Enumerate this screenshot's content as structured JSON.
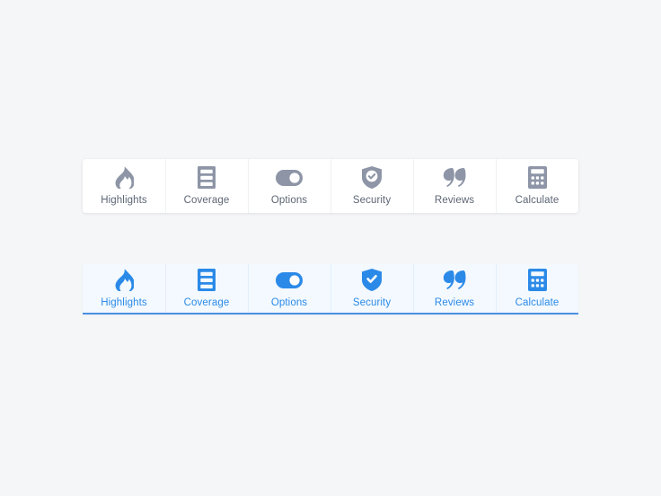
{
  "page": {
    "background_color": "#f5f6f7"
  },
  "colors": {
    "inactive_icon": "#8d95a6",
    "inactive_label": "#5d6675",
    "inactive_background": "#ffffff",
    "inactive_divider": "#f0f1f3",
    "active_icon": "#2b8ae8",
    "active_label": "#2b8ae8",
    "active_background": "#f3f9fe",
    "active_divider": "#e2eefb",
    "active_underline": "#4a90e2"
  },
  "tabbars": [
    {
      "name": "inactive-tabbar",
      "state": "default",
      "tabs": [
        {
          "label": "Highlights",
          "icon": "flame-icon"
        },
        {
          "label": "Coverage",
          "icon": "document-lines-icon"
        },
        {
          "label": "Options",
          "icon": "toggle-icon"
        },
        {
          "label": "Security",
          "icon": "shield-check-icon"
        },
        {
          "label": "Reviews",
          "icon": "quote-icon"
        },
        {
          "label": "Calculate",
          "icon": "calculator-icon"
        }
      ]
    },
    {
      "name": "active-tabbar",
      "state": "active",
      "tabs": [
        {
          "label": "Highlights",
          "icon": "flame-icon"
        },
        {
          "label": "Coverage",
          "icon": "document-lines-icon"
        },
        {
          "label": "Options",
          "icon": "toggle-icon"
        },
        {
          "label": "Security",
          "icon": "shield-check-icon"
        },
        {
          "label": "Reviews",
          "icon": "quote-icon"
        },
        {
          "label": "Calculate",
          "icon": "calculator-icon"
        }
      ]
    }
  ]
}
